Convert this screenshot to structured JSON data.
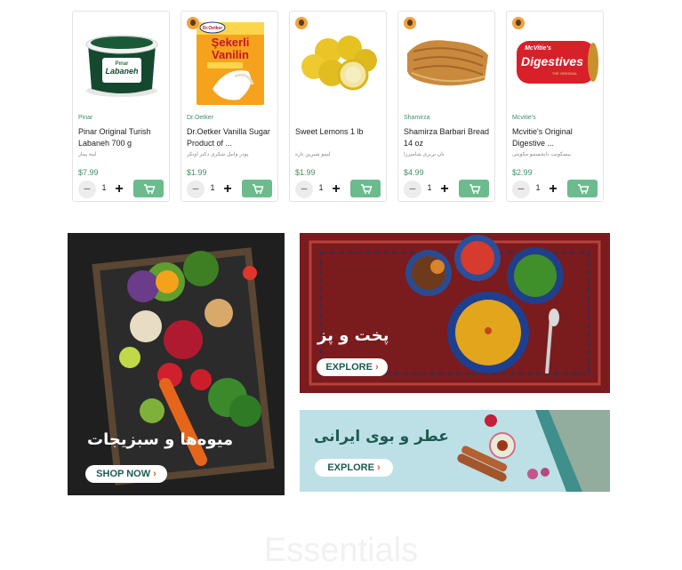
{
  "products": [
    {
      "brand": "Pinar",
      "name": "Pinar Original Turish Labaneh 700 g",
      "name_fa": "لبنه پینار",
      "price": "$7.99",
      "qty": "1",
      "has_vendor_avatar": false
    },
    {
      "brand": "Dr.Oetker",
      "name": "Dr.Oetker Vanilla Sugar Product of ...",
      "name_fa": "پودر وانیل شکری دکتر اوتکر",
      "price": "$1.99",
      "qty": "1",
      "has_vendor_avatar": true
    },
    {
      "brand": "",
      "name": "Sweet Lemons 1 lb",
      "name_fa": "لیمو شیرین تازه",
      "price": "$1.99",
      "qty": "1",
      "has_vendor_avatar": true
    },
    {
      "brand": "Shamirza",
      "name": "Shamirza Barbari Bread 14 oz",
      "name_fa": "نان بربری شامیرزا",
      "price": "$4.99",
      "qty": "1",
      "has_vendor_avatar": true
    },
    {
      "brand": "Mcvitie's",
      "name": "Mcvitie's Original Digestive ...",
      "name_fa": "بیسکویت دایجستیو مکویتی",
      "price": "$2.99",
      "qty": "1",
      "has_vendor_avatar": true
    }
  ],
  "product_image_text": {
    "labaneh_brand": "Pınar",
    "labaneh_label": "Labaneh",
    "oetker_brand": "Dr.Oetker",
    "oetker_line1": "Şekerli",
    "oetker_line2": "Vanilin",
    "digestive_brand": "McVitie's",
    "digestive_label": "Digestives",
    "digestive_sub": "THE ORIGINAL"
  },
  "banners": {
    "fruits": {
      "title": "میوه‌ها و سبزیجات",
      "button": "SHOP NOW"
    },
    "cooking": {
      "title": "پخت و پز",
      "button": "EXPLORE"
    },
    "spices": {
      "title": "عطر و بوی ایرانی",
      "button": "EXPLORE"
    }
  },
  "icons": {
    "minus": "minus-icon",
    "plus": "plus-icon",
    "cart": "cart-icon",
    "arrow": "chevron-right-icon"
  },
  "section_heading": "Essentials",
  "colors": {
    "accent_green": "#6bbb8d",
    "brand_text_green": "#3f8f6a",
    "button_text": "#1d5b52",
    "arrow_orange": "#e2572d"
  }
}
